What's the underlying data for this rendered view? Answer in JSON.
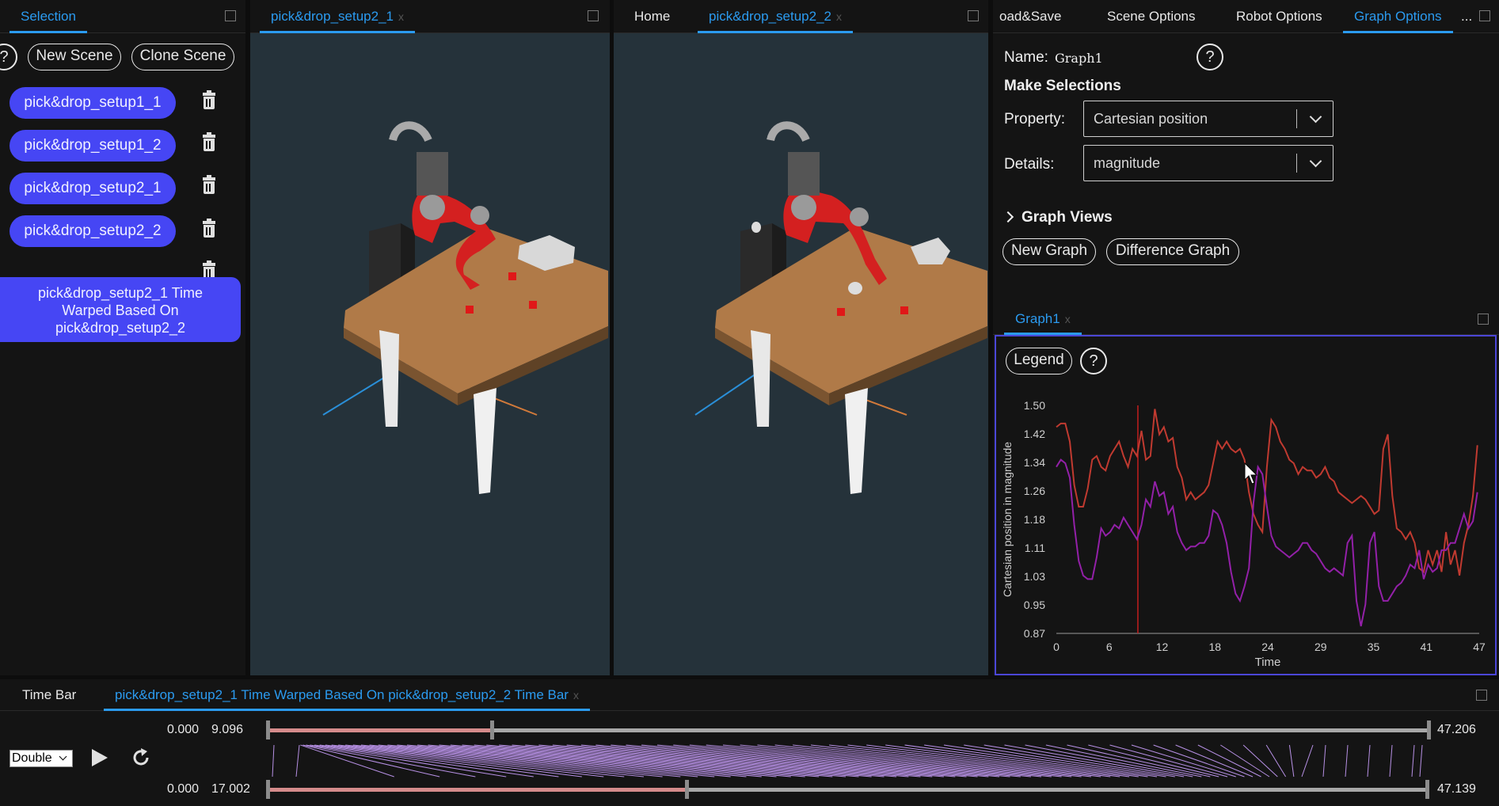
{
  "selection_panel": {
    "tab_label": "Selection",
    "help_label": "?",
    "new_scene_label": "New Scene",
    "clone_scene_label": "Clone Scene",
    "scenes": [
      "pick&drop_setup1_1",
      "pick&drop_setup1_2",
      "pick&drop_setup2_1",
      "pick&drop_setup2_2"
    ],
    "warped_scene": [
      "pick&drop_setup2_1 Time",
      "Warped Based On",
      "pick&drop_setup2_2"
    ]
  },
  "viewport1": {
    "tab_label": "pick&drop_setup2_1",
    "close": "x"
  },
  "viewport2": {
    "home_label": "Home",
    "tab_label": "pick&drop_setup2_2",
    "close": "x"
  },
  "options_panel": {
    "tabs": [
      "oad&Save",
      "Scene Options",
      "Robot Options",
      "Graph Options",
      "..."
    ],
    "active_tab": "Graph Options",
    "name_label": "Name:",
    "name_value": "Graph1",
    "make_selections": "Make Selections",
    "property_label": "Property:",
    "property_value": "Cartesian position",
    "details_label": "Details:",
    "details_value": "magnitude",
    "graph_views": "Graph Views",
    "new_graph_label": "New Graph",
    "difference_graph_label": "Difference Graph",
    "help_label": "?"
  },
  "graph_panel": {
    "tab_label": "Graph1",
    "close": "x",
    "legend_label": "Legend",
    "help_label": "?"
  },
  "chart_data": {
    "type": "line",
    "title": "",
    "xlabel": "Time",
    "ylabel": "Cartesian position in magnitude",
    "xlim": [
      0,
      47.2
    ],
    "ylim": [
      0.87,
      1.5
    ],
    "x_ticks": [
      "0",
      "6",
      "12",
      "18",
      "24",
      "29",
      "35",
      "41",
      "47"
    ],
    "y_ticks": [
      "1.50",
      "1.42",
      "1.34",
      "1.26",
      "1.18",
      "1.11",
      "1.03",
      "0.95",
      "0.87"
    ],
    "current_time": 9.1,
    "colors": {
      "series_red": "#c03a30",
      "series_purple": "#9320a8",
      "cursor": "#c21e1e"
    },
    "series": [
      {
        "x": [
          0,
          0.5,
          1,
          1.5,
          2,
          2.5,
          3,
          3.5,
          4,
          4.5,
          5,
          5.5,
          6,
          6.5,
          7,
          7.5,
          8,
          8.5,
          9,
          9.5,
          10,
          10.5,
          11,
          11.5,
          12,
          12.5,
          13,
          13.5,
          14,
          14.5,
          15,
          15.5,
          16,
          16.5,
          17,
          17.5,
          18,
          18.5,
          19,
          19.5,
          20,
          20.5,
          21,
          21.5,
          22,
          22.5,
          23,
          23.5,
          24,
          24.5,
          25,
          25.5,
          26,
          26.5,
          27,
          27.5,
          28,
          28.5,
          29,
          29.5,
          30,
          30.5,
          31,
          31.5,
          32,
          32.5,
          33,
          33.5,
          34,
          34.5,
          35,
          35.5,
          36,
          36.5,
          37,
          37.5,
          38,
          38.5,
          39,
          39.5,
          40,
          40.5,
          41,
          41.5,
          42,
          42.5,
          43,
          43.5,
          44,
          44.5,
          45,
          45.5,
          46,
          46.5,
          47
        ],
        "y": [
          1.44,
          1.45,
          1.45,
          1.4,
          1.28,
          1.22,
          1.22,
          1.27,
          1.35,
          1.36,
          1.33,
          1.32,
          1.36,
          1.38,
          1.4,
          1.36,
          1.33,
          1.38,
          1.36,
          1.43,
          1.35,
          1.36,
          1.49,
          1.42,
          1.44,
          1.4,
          1.41,
          1.33,
          1.3,
          1.24,
          1.26,
          1.24,
          1.25,
          1.26,
          1.28,
          1.34,
          1.4,
          1.38,
          1.4,
          1.38,
          1.37,
          1.38,
          1.35,
          1.26,
          1.2,
          1.17,
          1.15,
          1.33,
          1.46,
          1.44,
          1.4,
          1.38,
          1.35,
          1.34,
          1.31,
          1.33,
          1.32,
          1.32,
          1.3,
          1.31,
          1.33,
          1.3,
          1.29,
          1.26,
          1.25,
          1.24,
          1.23,
          1.24,
          1.25,
          1.24,
          1.22,
          1.2,
          1.21,
          1.38,
          1.42,
          1.25,
          1.16,
          1.15,
          1.13,
          1.15,
          1.12,
          1.05,
          1.04,
          1.1,
          1.06,
          1.1,
          1.04,
          1.15,
          1.06,
          1.1,
          1.03,
          1.12,
          1.17,
          1.25,
          1.39
        ]
      },
      {
        "x": [
          0,
          0.5,
          1,
          1.5,
          2,
          2.5,
          3,
          3.5,
          4,
          4.5,
          5,
          5.5,
          6,
          6.5,
          7,
          7.5,
          8,
          8.5,
          9,
          9.5,
          10,
          10.5,
          11,
          11.5,
          12,
          12.5,
          13,
          13.5,
          14,
          14.5,
          15,
          15.5,
          16,
          16.5,
          17,
          17.5,
          18,
          18.5,
          19,
          19.5,
          20,
          20.5,
          21,
          21.5,
          22,
          22.5,
          23,
          23.5,
          24,
          24.5,
          25,
          25.5,
          26,
          26.5,
          27,
          27.5,
          28,
          28.5,
          29,
          29.5,
          30,
          30.5,
          31,
          31.5,
          32,
          32.5,
          33,
          33.5,
          34,
          34.5,
          35,
          35.5,
          36,
          36.5,
          37,
          37.5,
          38,
          38.5,
          39,
          39.5,
          40,
          40.5,
          41,
          41.5,
          42,
          42.5,
          43,
          43.5,
          44,
          44.5,
          45,
          45.5,
          46,
          46.5,
          47
        ],
        "y": [
          1.33,
          1.35,
          1.34,
          1.3,
          1.17,
          1.07,
          1.03,
          1.02,
          1.02,
          1.08,
          1.16,
          1.14,
          1.15,
          1.17,
          1.16,
          1.19,
          1.17,
          1.15,
          1.13,
          1.17,
          1.24,
          1.22,
          1.29,
          1.25,
          1.26,
          1.2,
          1.22,
          1.15,
          1.12,
          1.1,
          1.11,
          1.11,
          1.12,
          1.12,
          1.14,
          1.21,
          1.2,
          1.17,
          1.12,
          1.04,
          0.98,
          0.96,
          1.0,
          1.05,
          1.23,
          1.33,
          1.31,
          1.22,
          1.14,
          1.11,
          1.1,
          1.09,
          1.08,
          1.09,
          1.1,
          1.12,
          1.12,
          1.1,
          1.09,
          1.07,
          1.05,
          1.04,
          1.05,
          1.04,
          1.03,
          1.12,
          1.14,
          0.96,
          0.89,
          0.95,
          1.12,
          1.15,
          1.0,
          0.96,
          0.96,
          0.98,
          1.0,
          1.01,
          1.03,
          1.06,
          1.05,
          1.1,
          1.02,
          1.06,
          1.04,
          1.05,
          1.1,
          1.1,
          1.12,
          1.12,
          1.16,
          1.2,
          1.16,
          1.18,
          1.26
        ]
      }
    ]
  },
  "timebar": {
    "tab_label": "Time Bar",
    "warped_tab_label": "pick&drop_setup2_1 Time Warped Based On pick&drop_setup2_2 Time Bar",
    "close": "x",
    "speed_value": "Double",
    "top": {
      "start": "0.000",
      "current": "9.096",
      "end": "47.206",
      "progress": 0.193
    },
    "bottom": {
      "start": "0.000",
      "current": "17.002",
      "end": "47.139",
      "progress": 0.361
    }
  }
}
